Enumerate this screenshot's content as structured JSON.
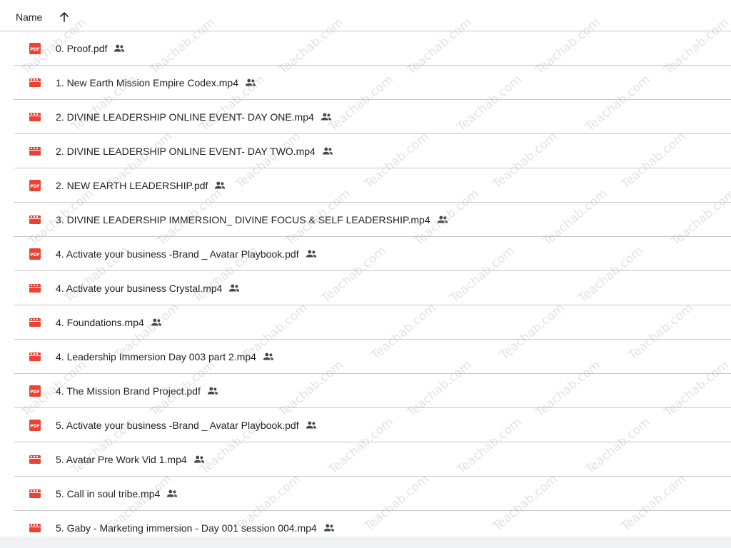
{
  "header": {
    "name_label": "Name",
    "sort_direction": "ascending"
  },
  "colors": {
    "video_icon": "#ea4335",
    "pdf_icon": "#ea4335",
    "divider": "#c7c7c7",
    "text": "#1f1f1f",
    "shared_icon": "#444746"
  },
  "files": [
    {
      "name": "0. Proof.pdf",
      "type": "pdf",
      "shared": true
    },
    {
      "name": "1. New Earth Mission Empire Codex.mp4",
      "type": "video",
      "shared": true
    },
    {
      "name": "2. DIVINE LEADERSHIP ONLINE EVENT- DAY ONE.mp4",
      "type": "video",
      "shared": true
    },
    {
      "name": "2. DIVINE LEADERSHIP ONLINE EVENT- DAY TWO.mp4",
      "type": "video",
      "shared": true
    },
    {
      "name": "2. NEW EARTH LEADERSHIP.pdf",
      "type": "pdf",
      "shared": true
    },
    {
      "name": "3. DIVINE LEADERSHIP IMMERSION_ DIVINE FOCUS & SELF LEADERSHIP.mp4",
      "type": "video",
      "shared": true
    },
    {
      "name": "4. Activate your business -Brand _ Avatar Playbook.pdf",
      "type": "pdf",
      "shared": true
    },
    {
      "name": "4. Activate your business Crystal.mp4",
      "type": "video",
      "shared": true
    },
    {
      "name": "4. Foundations.mp4",
      "type": "video",
      "shared": true
    },
    {
      "name": "4. Leadership Immersion Day 003 part 2.mp4",
      "type": "video",
      "shared": true
    },
    {
      "name": "4. The Mission Brand Project.pdf",
      "type": "pdf",
      "shared": true
    },
    {
      "name": "5. Activate your business -Brand _ Avatar Playbook.pdf",
      "type": "pdf",
      "shared": true
    },
    {
      "name": "5. Avatar Pre Work Vid 1.mp4",
      "type": "video",
      "shared": true
    },
    {
      "name": "5. Call in soul tribe.mp4",
      "type": "video",
      "shared": true
    },
    {
      "name": "5. Gaby - Marketing immersion - Day 001 session 004.mp4",
      "type": "video",
      "shared": true
    }
  ],
  "watermark": {
    "text": "Teachab.com"
  }
}
